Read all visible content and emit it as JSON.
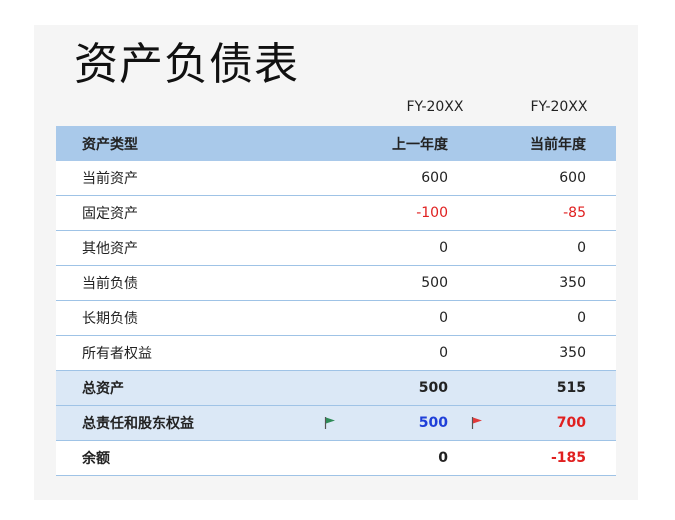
{
  "title": "资产负债表",
  "years": {
    "prev": "FY-20XX",
    "curr": "FY-20XX"
  },
  "header": {
    "type": "资产类型",
    "prev": "上一年度",
    "curr": "当前年度"
  },
  "rows": [
    {
      "label": "当前资产",
      "prev": "600",
      "curr": "600"
    },
    {
      "label": "固定资产",
      "prev": "-100",
      "curr": "-85"
    },
    {
      "label": "其他资产",
      "prev": "0",
      "curr": "0"
    },
    {
      "label": "当前负债",
      "prev": "500",
      "curr": "350"
    },
    {
      "label": "长期负债",
      "prev": "0",
      "curr": "0"
    },
    {
      "label": "所有者权益",
      "prev": "0",
      "curr": "350"
    }
  ],
  "totals": [
    {
      "label": "总资产",
      "prev": "500",
      "curr": "515"
    },
    {
      "label": "总责任和股东权益",
      "prev": "500",
      "curr": "700",
      "prev_flag": "green-flag-icon",
      "curr_flag": "red-flag-icon"
    }
  ],
  "balance": {
    "label": "余额",
    "prev": "0",
    "curr": "-185"
  },
  "colors": {
    "header": "#a9c9ea",
    "total_row": "#dbe8f6",
    "negative": "#e02020",
    "blue_value": "#1f3fd8",
    "green_flag": "#2e8b57",
    "red_flag": "#e03a3a"
  }
}
